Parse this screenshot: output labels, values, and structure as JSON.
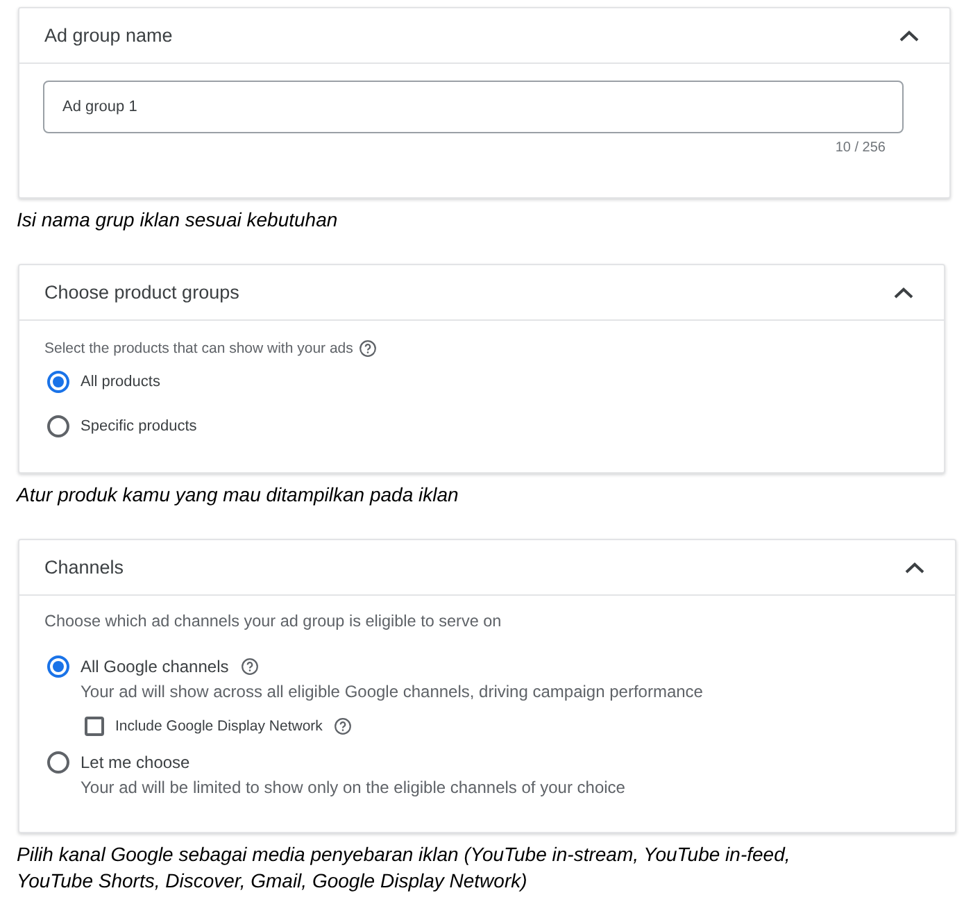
{
  "sections": [
    {
      "title": "Ad group name",
      "expanded": true,
      "field": {
        "value": "Ad group 1",
        "counter": "10 / 256"
      },
      "caption": "Isi nama grup iklan sesuai kebutuhan"
    },
    {
      "title": "Choose product groups",
      "expanded": true,
      "prompt": "Select the products that can show with your ads",
      "prompt_help": true,
      "options": [
        {
          "kind": "radio",
          "label": "All products",
          "help": false,
          "selected": true
        },
        {
          "kind": "radio",
          "label": "Specific products",
          "help": false,
          "selected": false
        }
      ],
      "caption": "Atur produk kamu yang mau ditampilkan pada iklan"
    },
    {
      "title": "Channels",
      "expanded": true,
      "prompt": "Choose which ad channels your ad group is eligible to serve on",
      "prompt_help": false,
      "options": [
        {
          "kind": "radio",
          "label": "All Google channels",
          "help": true,
          "selected": true,
          "description": "Your ad will show across all eligible Google channels, driving campaign performance",
          "children": [
            {
              "kind": "checkbox",
              "label": "Include Google Display Network",
              "help": true,
              "checked": false
            }
          ]
        },
        {
          "kind": "radio",
          "label": "Let me choose",
          "help": false,
          "selected": false,
          "description": "Your ad will be limited to show only on the eligible channels of your choice"
        }
      ],
      "caption": "Pilih kanal Google sebagai media penyebaran iklan (YouTube in-stream, YouTube in-feed, YouTube Shorts, Discover, Gmail, Google Display Network)"
    }
  ]
}
